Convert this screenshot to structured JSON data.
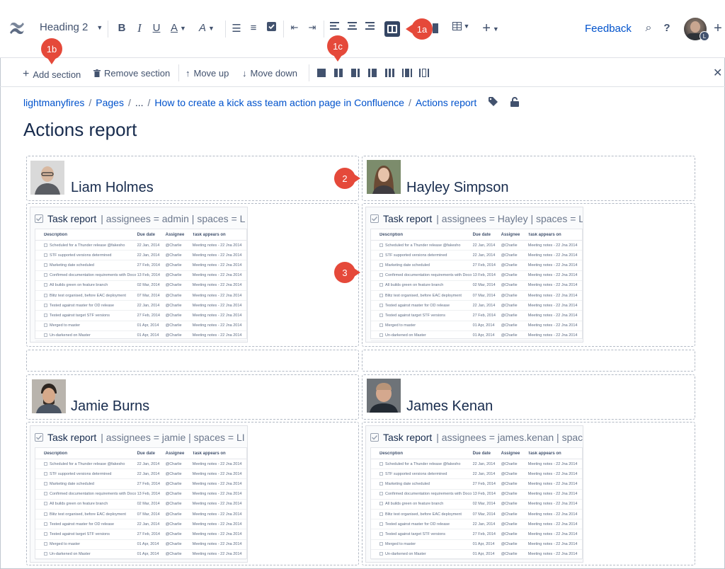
{
  "toolbar": {
    "text_style": "Heading 2",
    "bold": "B",
    "italic": "I",
    "underline": "U",
    "text_color": "A",
    "clear_format": "A",
    "feedback": "Feedback",
    "search": "⌕",
    "help": "?",
    "insert": "+",
    "avatar_badge": "L"
  },
  "section_toolbar": {
    "add_section": "Add section",
    "remove_section": "Remove section",
    "move_up": "Move up",
    "move_down": "Move down"
  },
  "breadcrumb": [
    "lightmanyfires",
    "Pages",
    "...",
    "How to create a kick ass team action page in Confluence",
    "Actions report"
  ],
  "page_title": "Actions report",
  "people": [
    {
      "name": "Liam Holmes",
      "task_header": "Task report",
      "params": "| assignees = admin | spaces = L"
    },
    {
      "name": "Hayley Simpson",
      "task_header": "Task report",
      "params": "| assignees = Hayley | spaces = L"
    },
    {
      "name": "Jamie Burns",
      "task_header": "Task report",
      "params": "| assignees = jamie | spaces = LI"
    },
    {
      "name": "James Kenan",
      "task_header": "Task report",
      "params": "| assignees = james.kenan | spac"
    }
  ],
  "task_table": {
    "headers": [
      "Description",
      "Due date",
      "Assignee",
      "Task appears on"
    ],
    "rows": [
      [
        "Scheduled for a Thunder release @fakesho",
        "22 Jan, 2014",
        "@Charlie",
        "Meeting notes - 22 Jna 2014"
      ],
      [
        "STF supported versions determined",
        "22 Jan, 2014",
        "@Charlie",
        "Meeting notes - 22 Jna 2014"
      ],
      [
        "Marketing date scheduled",
        "27 Feb, 2014",
        "@Charlie",
        "Meeting notes - 22 Jna 2014"
      ],
      [
        "Confirmed documentation requirements with Doco team",
        "13 Feb, 2014",
        "@Charlie",
        "Meeting notes - 22 Jna 2014"
      ],
      [
        "All builds green on feature branch",
        "02 Mar, 2014",
        "@Charlie",
        "Meeting notes - 22 Jna 2014"
      ],
      [
        "Blitz test organised, before EAC deployment",
        "07 Mar, 2014",
        "@Charlie",
        "Meeting notes - 22 Jna 2014"
      ],
      [
        "Tested against master for OD release",
        "22 Jan, 2014",
        "@Charlie",
        "Meeting notes - 22 Jna 2014"
      ],
      [
        "Tested against target STF versions",
        "27 Feb, 2014",
        "@Charlie",
        "Meeting notes - 22 Jna 2014"
      ],
      [
        "Merged to master",
        "01 Apr, 2014",
        "@Charlie",
        "Meeting notes - 22 Jna 2014"
      ],
      [
        "Un-darkened on Master",
        "01 Apr, 2014",
        "@Charlie",
        "Meeting notes - 22 Jna 2014"
      ]
    ]
  },
  "callouts": [
    "1a",
    "1b",
    "1c",
    "2",
    "3"
  ],
  "colors": {
    "link": "#0052cc",
    "callout": "#e5493a",
    "text": "#172b4d"
  }
}
